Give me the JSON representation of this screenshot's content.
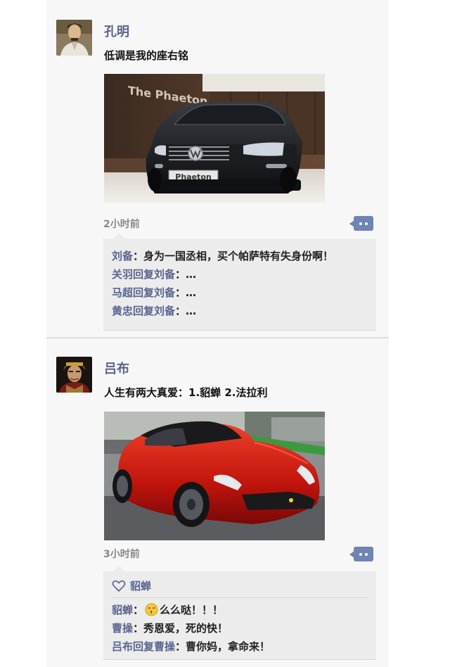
{
  "posts": [
    {
      "author": "孔明",
      "avatar_icon": "avatar-kongming",
      "text": "低调是我的座右铭",
      "photo": {
        "icon": "car-phaeton-photo",
        "wall_text": "The Phaeton",
        "plate_text": "Phaeton"
      },
      "time": "2小时前",
      "comments": [
        {
          "author": "刘备",
          "sep": "：",
          "text": "身为一国丞相，买个帕萨特有失身份啊！"
        },
        {
          "author": "关羽回复刘备",
          "sep": "：",
          "text": "…"
        },
        {
          "author": "马超回复刘备",
          "sep": "：",
          "text": "…"
        },
        {
          "author": "黄忠回复刘备",
          "sep": "：",
          "text": "…"
        }
      ]
    },
    {
      "author": "吕布",
      "avatar_icon": "avatar-lvbu",
      "text": "人生有两大真爱：1.貂蝉  2.法拉利",
      "photo": {
        "icon": "car-ferrari-photo"
      },
      "time": "3小时前",
      "likes": {
        "icon": "heart-icon",
        "names": "貂蝉"
      },
      "comments": [
        {
          "author": "貂蝉",
          "sep": "：",
          "emoji": "kiss-emoji",
          "text": "么么哒！！！"
        },
        {
          "author": "曹操",
          "sep": "：",
          "text": "秀恩爱，死的快！"
        },
        {
          "author": "吕布回复曹操",
          "sep": "：",
          "text": "曹你妈，拿命来！"
        }
      ]
    }
  ],
  "colors": {
    "name": "#5a6390",
    "comment_bg": "#ececec",
    "button": "#6d84b4",
    "feed_bg": "#f7f7f7"
  }
}
